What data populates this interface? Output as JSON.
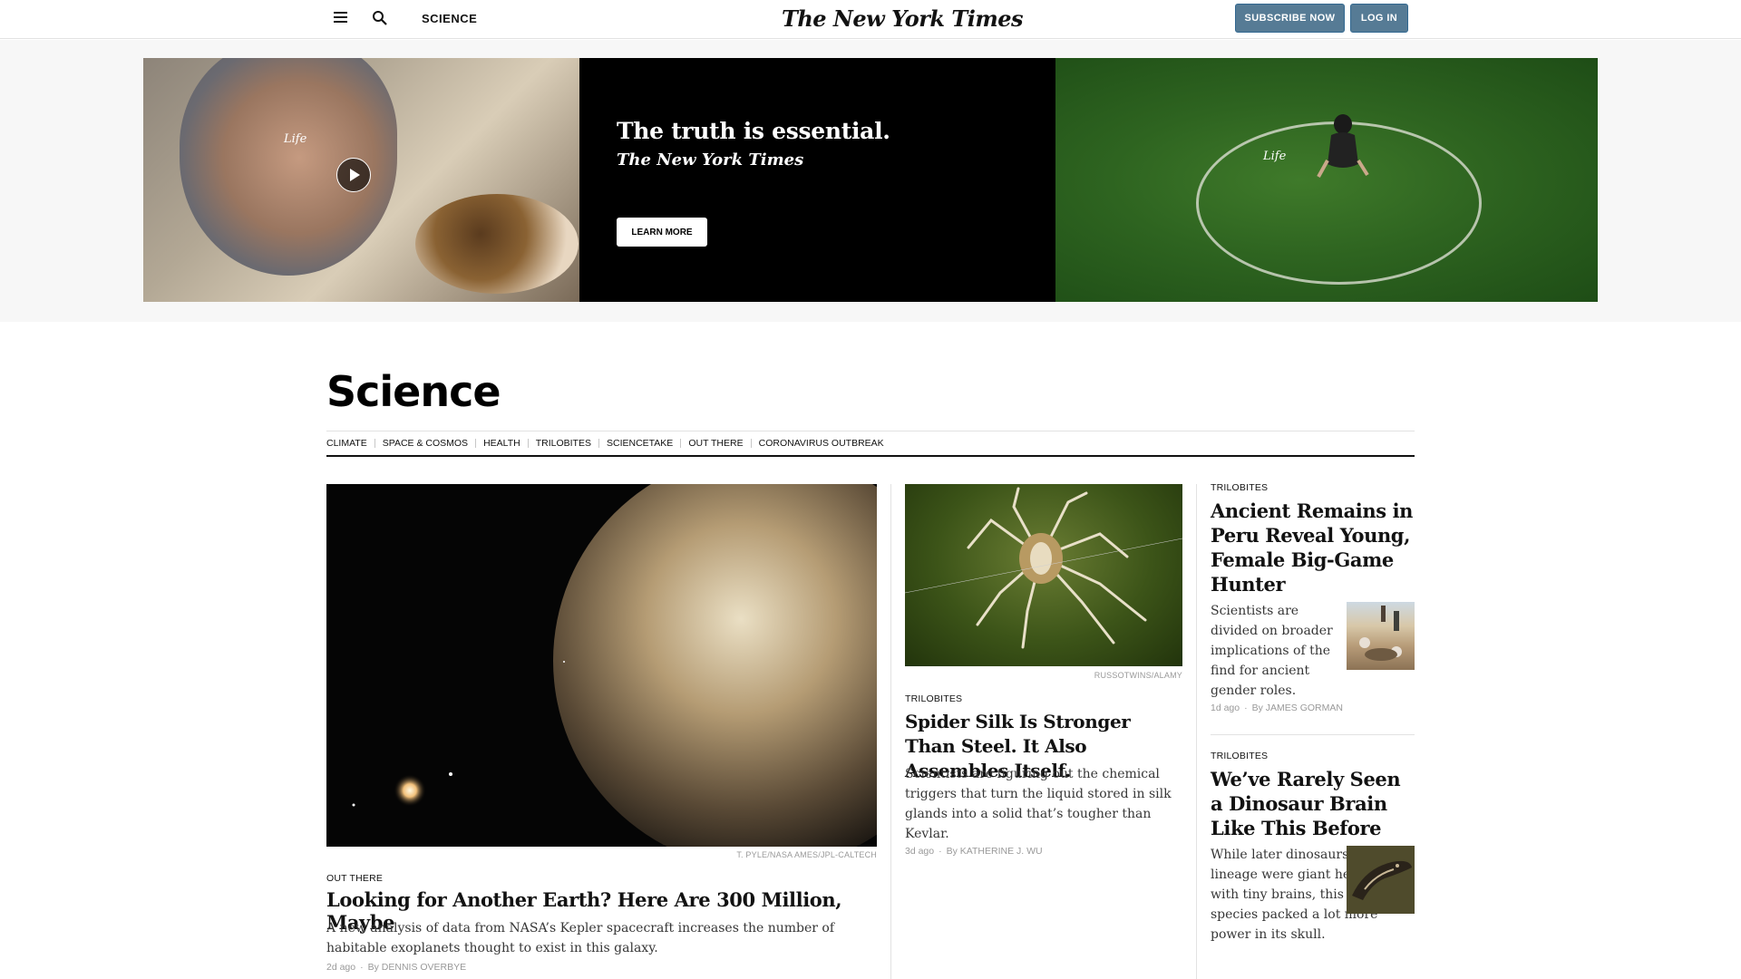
{
  "header": {
    "section_label": "SCIENCE",
    "masthead": "The New York Times",
    "subscribe_label": "SUBSCRIBE NOW",
    "login_label": "LOG IN"
  },
  "ad": {
    "left_caption": "Life",
    "right_caption": "Life",
    "headline": "The truth is essential.",
    "brand": "The New York Times",
    "cta": "LEARN MORE"
  },
  "section": {
    "title": "Science",
    "subnav": [
      "CLIMATE",
      "SPACE & COSMOS",
      "HEALTH",
      "TRILOBITES",
      "SCIENCETAKE",
      "OUT THERE",
      "CORONAVIRUS OUTBREAK"
    ]
  },
  "articles": {
    "lead": {
      "credit": "T. PYLE/NASA AMES/JPL-CALTECH",
      "kicker": "OUT THERE",
      "headline": "Looking for Another Earth? Here Are 300 Million, Maybe",
      "summary": "A new analysis of data from NASA’s Kepler spacecraft increases the number of habitable exoplanets thought to exist in this galaxy.",
      "age": "2d ago",
      "byline": "By DENNIS OVERBYE"
    },
    "second": {
      "credit": "RUSSOTWINS/ALAMY",
      "kicker": "TRILOBITES",
      "headline": "Spider Silk Is Stronger Than Steel. It Also Assembles Itself.",
      "summary": "Scientists are figuring out the chemical triggers that turn the liquid stored in silk glands into a solid that’s tougher than Kevlar.",
      "age": "3d ago",
      "byline": "By KATHERINE J. WU"
    },
    "third": {
      "kicker": "TRILOBITES",
      "headline": "Ancient Remains in Peru Reveal Young, Female Big-Game Hunter",
      "summary": "Scientists are divided on broader implications of the find for ancient gender roles.",
      "age": "1d ago",
      "byline": "By JAMES GORMAN"
    },
    "fourth": {
      "kicker": "TRILOBITES",
      "headline": "We’ve Rarely Seen a Dinosaur Brain Like This Before",
      "summary": "While later dinosaurs in this lineage were giant herbivores with tiny brains, this small species packed a lot more power in its skull."
    }
  }
}
